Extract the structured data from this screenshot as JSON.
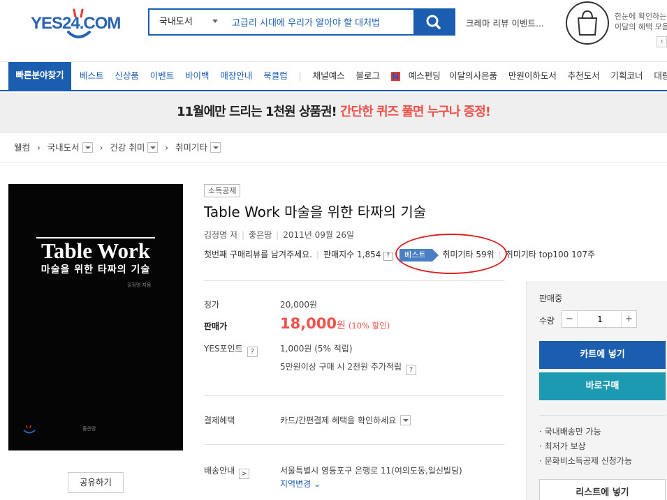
{
  "header": {
    "logo": "YES24.COM",
    "search_category": "국내도서",
    "search_query": "고급리 시대에 우리가 알아야 할 대처법",
    "event_link": "크레마 리뷰 이벤트...",
    "promo_line1": "한눈에 확인하는",
    "promo_line2": "이달의 혜택 모음",
    "prev_arrow": "‹"
  },
  "nav": {
    "quick": "빠른분야찾기",
    "items": [
      "베스트",
      "신상품",
      "이벤트",
      "바이백",
      "매장안내",
      "북클럽",
      "채널예스",
      "블로그",
      "예스펀딩"
    ],
    "n_badge": "N",
    "right_items": [
      "이달의사은품",
      "만원이하도서",
      "추천도서",
      "기획코너",
      "대량/법"
    ]
  },
  "banner": {
    "part1": "11월에만 드리는 1천원 상품권! ",
    "part2": "간단한 퀴즈 풀면 누구나 증정!"
  },
  "breadcrumb": {
    "home": "웰컴",
    "items": [
      "국내도서",
      "건강 취미",
      "취미기타"
    ]
  },
  "cover": {
    "title_en": "Table Work",
    "title_ko": "마술을 위한 타짜의 기술",
    "author_small": "김정명 지음",
    "publisher_small": "좋은땅"
  },
  "product": {
    "tag": "소득공제",
    "title": "Table Work 마술을 위한 타짜의 기술",
    "author": "김정명 저",
    "publisher": "좋은땅",
    "date": "2011년 09월 26일",
    "review_prompt": "첫번째 구매리뷰를 남겨주세요.",
    "sales_index": "판매지수 1,854",
    "best_badge": "베스트",
    "rank1": "취미기타 59위",
    "rank2": "취미기타 top100 107주",
    "q": "?"
  },
  "price": {
    "list_label": "정가",
    "list_value": "20,000원",
    "sale_label": "판매가",
    "sale_value": "18,000",
    "sale_unit": "원",
    "discount": "(10% 할인)",
    "point_label": "YES포인트",
    "point_value": "1,000원 (5% 적립)",
    "point_extra": "5만원이상 구매 시 2천원 추가적립"
  },
  "benefits": {
    "label": "결제혜택",
    "value": "카드/간편결제 혜택을 확인하세요"
  },
  "delivery": {
    "label": "배송안내",
    "address": "서울특별시 영등포구 은행로 11(여의도동,일신빌딩)",
    "change_link": "지역변경",
    "arrow": ">"
  },
  "share": {
    "label": "공유하기"
  },
  "side": {
    "status": "판매중",
    "qty_label": "수량",
    "qty_value": "1",
    "minus": "−",
    "plus": "+",
    "cart": "카트에 넣기",
    "buy": "바로구매",
    "notes": [
      "· 국내배송만 가능",
      "· 최저가 보상",
      "· 문화비소득공제 신청가능"
    ],
    "list": "리스트에 넣기"
  },
  "colors": {
    "brand_blue": "#1b5eb0",
    "price_red": "#f0524b",
    "buy_teal": "#1c9ab2",
    "highlight_ring": "#e02020"
  }
}
